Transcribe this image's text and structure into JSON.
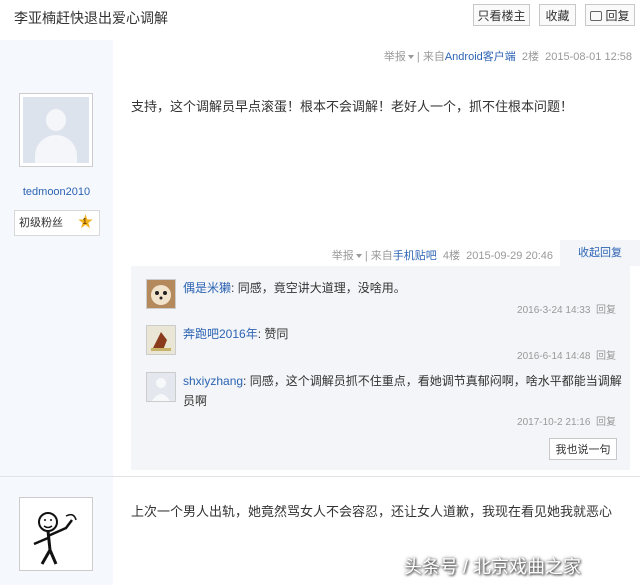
{
  "header": {
    "title": "李亚楠赶快退出爱心调解",
    "btn_author_only": "只看楼主",
    "btn_favorite": "收藏",
    "btn_reply": "回复"
  },
  "post1": {
    "report": "举报",
    "source_prefix": "来自",
    "source_link": "Android客户端",
    "floor": "2楼",
    "time": "2015-08-01 12:58",
    "username": "tedmoon2010",
    "badge_label": "初级粉丝",
    "badge_level": "1",
    "content": "支持，这个调解员早点滚蛋！根本不会调解！老好人一个，抓不住根本问题！"
  },
  "post1_sub_meta": {
    "report": "举报",
    "source_prefix": "来自",
    "source_link": "手机贴吧",
    "floor": "4楼",
    "time": "2015-09-29 20:46",
    "fold_reply": "收起回复"
  },
  "sub_replies": [
    {
      "user": "偶是米獭",
      "text": "同感，竟空讲大道理，没啥用。",
      "time": "2016-3-24 14:33",
      "reply": "回复"
    },
    {
      "user": "奔跑吧2016年",
      "text": "赞同",
      "time": "2016-6-14 14:48",
      "reply": "回复"
    },
    {
      "user": "shxiyzhang",
      "text": "同感，这个调解员抓不住重点，看她调节真郁闷啊，啥水平都能当调解员啊",
      "time": "2017-10-2 21:16",
      "reply": "回复"
    }
  ],
  "say_button": "我也说一句",
  "post2": {
    "content": "上次一个男人出轨，她竟然骂女人不会容忍，还让女人道歉，我现在看见她我就恶心"
  },
  "watermark": "头条号 / 北京戏曲之家",
  "colors": {
    "link": "#2d64b3",
    "sidebar_bg": "#f5f8fc",
    "subbox_bg": "#f3f5f8",
    "meta": "#999999"
  }
}
